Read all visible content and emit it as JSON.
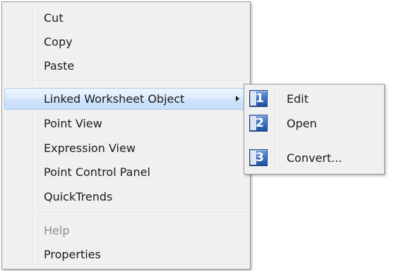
{
  "context_menu": {
    "items": [
      {
        "label": "Cut"
      },
      {
        "label": "Copy"
      },
      {
        "label": "Paste"
      },
      {
        "label": "Linked Worksheet Object"
      },
      {
        "label": "Point View"
      },
      {
        "label": "Expression View"
      },
      {
        "label": "Point Control Panel"
      },
      {
        "label": "QuickTrends"
      },
      {
        "label": "Help"
      },
      {
        "label": "Properties"
      }
    ]
  },
  "submenu": {
    "items": [
      {
        "number": "1",
        "label": "Edit"
      },
      {
        "number": "2",
        "label": "Open"
      },
      {
        "number": "3",
        "label": "Convert..."
      }
    ]
  }
}
